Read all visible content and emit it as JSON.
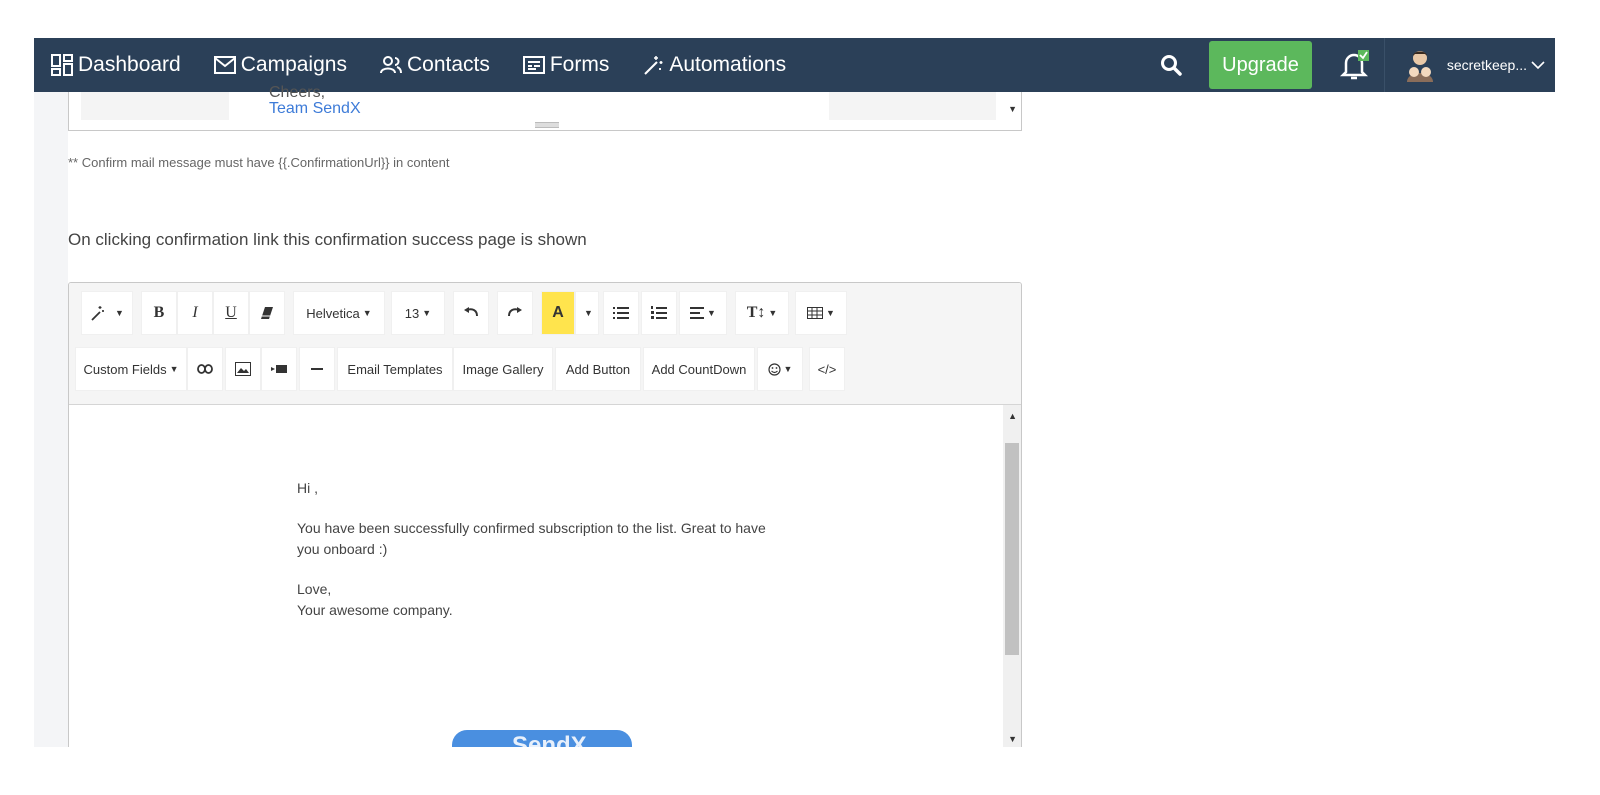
{
  "nav": {
    "items": [
      {
        "label": "Dashboard",
        "icon": "dashboard-icon"
      },
      {
        "label": "Campaigns",
        "icon": "envelope-icon"
      },
      {
        "label": "Contacts",
        "icon": "contacts-icon"
      },
      {
        "label": "Forms",
        "icon": "forms-icon"
      },
      {
        "label": "Automations",
        "icon": "magic-wand-icon"
      }
    ],
    "upgrade_label": "Upgrade",
    "username": "secretkeep..."
  },
  "upper_editor": {
    "cut_text": "Cheers,",
    "signature": "Team SendX"
  },
  "note": "** Confirm mail message must have {{.ConfirmationUrl}} in content",
  "section_label": "On clicking confirmation link this confirmation success page is shown",
  "toolbar": {
    "font_family": "Helvetica",
    "font_size": "13",
    "custom_fields": "Custom Fields",
    "email_templates": "Email Templates",
    "image_gallery": "Image Gallery",
    "add_button": "Add Button",
    "add_countdown": "Add CountDown",
    "code_view": "</>"
  },
  "message": {
    "greeting": "Hi ,",
    "line1": "You have been successfully confirmed subscription to the list. Great to have",
    "line2": "you onboard :)",
    "closing": "Love,",
    "signoff": "Your awesome company."
  },
  "pill_text": "SendX",
  "colors": {
    "nav_bg": "#2b4058",
    "upgrade_bg": "#5cb85c",
    "link": "#3d7bd8",
    "highlight": "#ffe44d"
  }
}
